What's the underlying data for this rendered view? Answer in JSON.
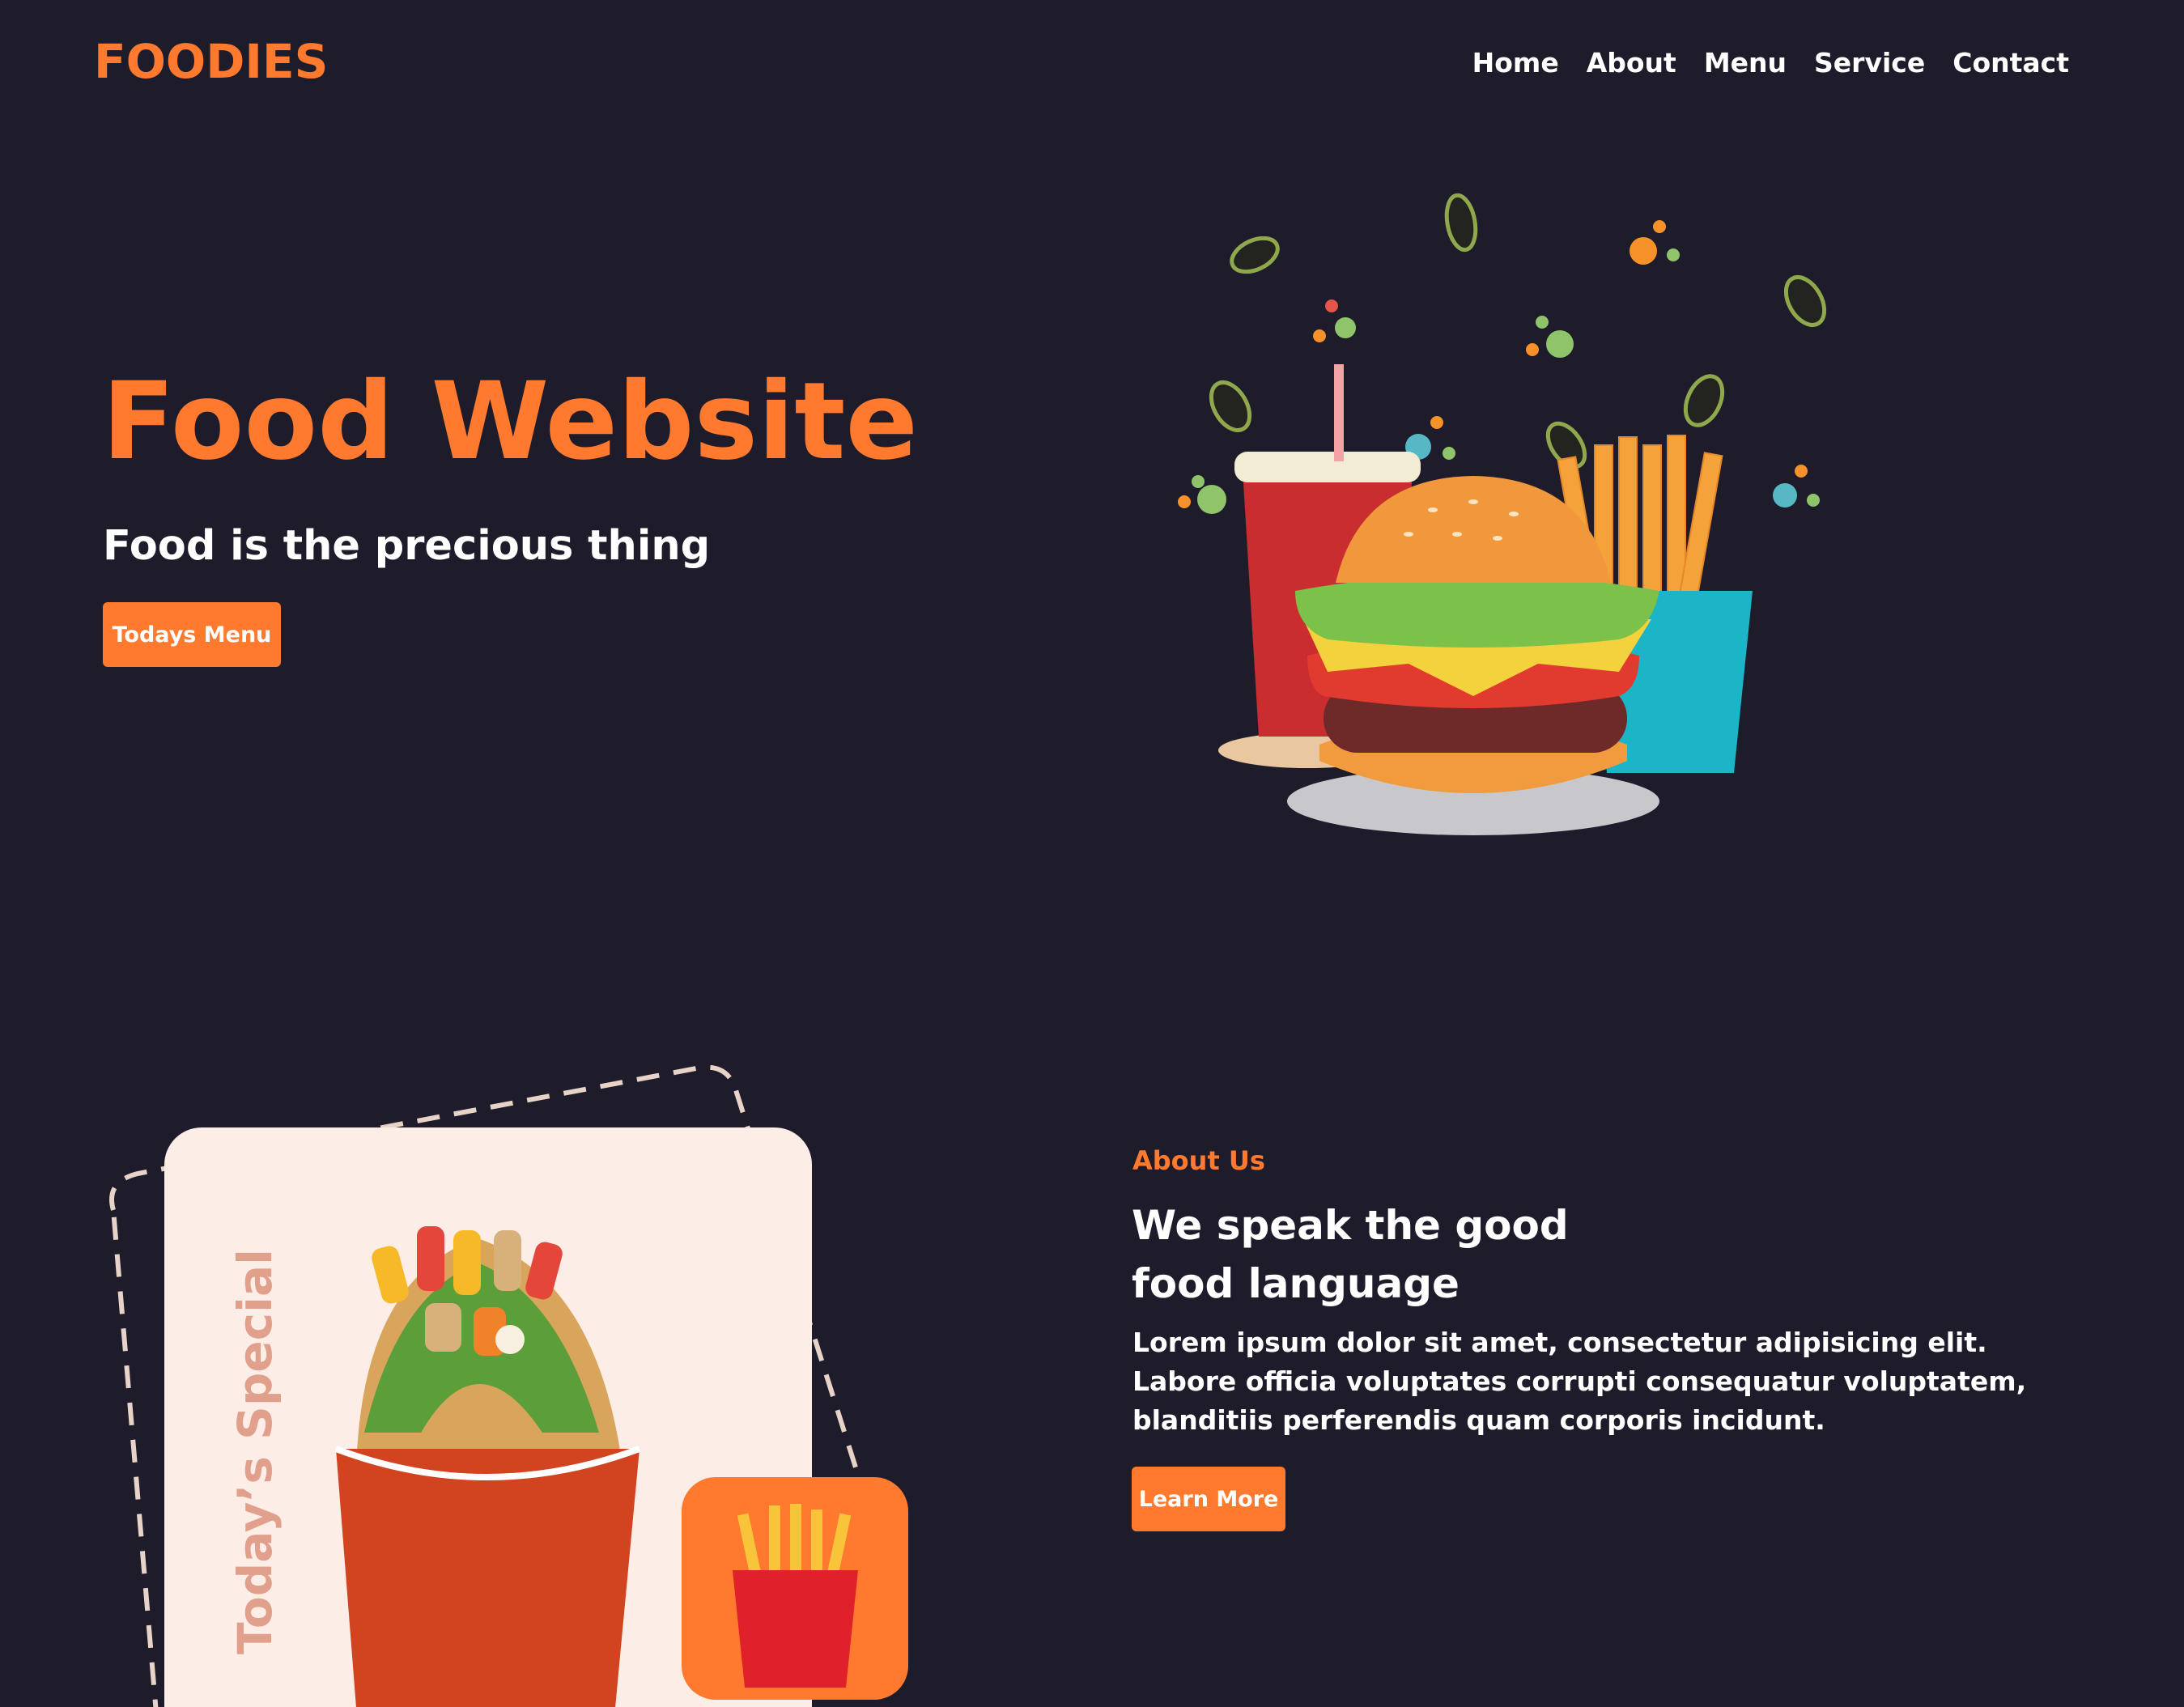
{
  "header": {
    "logo": "FOODIES",
    "nav": [
      "Home",
      "About",
      "Menu",
      "Service",
      "Contact"
    ]
  },
  "hero": {
    "title": "Food Website",
    "subtitle": "Food is the precious thing",
    "button_label": "Todays Menu"
  },
  "about": {
    "kicker": "About Us",
    "heading_line1": "We speak the good",
    "heading_line2": "food language",
    "paragraph": "Lorem ipsum dolor sit amet, consectetur adipisicing elit. Labore officia voluptates corrupti consequatur voluptatem, blanditiis perferendis quam corporis incidunt.",
    "button_label": "Learn More"
  },
  "special": {
    "label": "Today’s Special"
  },
  "colors": {
    "background": "#1e1c2b",
    "accent": "#ff7a2e",
    "card": "#fdede7"
  }
}
